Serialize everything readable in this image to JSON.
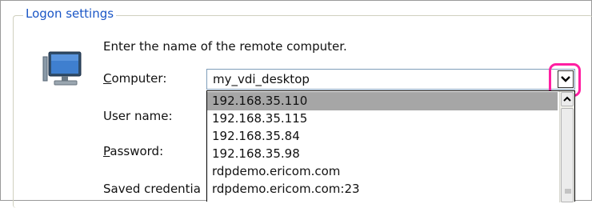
{
  "group": {
    "title": "Logon settings"
  },
  "instruction": "Enter the name of the remote computer.",
  "labels": {
    "computer": {
      "before": "",
      "mnemonic": "C",
      "after": "omputer:"
    },
    "username": "User name:",
    "password": {
      "before": "",
      "mnemonic": "P",
      "after": "assword:"
    },
    "saved": "Saved credentia"
  },
  "combo": {
    "value": "my_vdi_desktop"
  },
  "dropdown": {
    "items": [
      "192.168.35.110",
      "192.168.35.115",
      "192.168.35.84",
      "192.168.35.98",
      "rdpdemo.ericom.com",
      "rdpdemo.ericom.com:23"
    ],
    "selected_index": 0
  },
  "colors": {
    "group_title": "#1a56c6",
    "highlight": "#ff1fa2",
    "selected_item": "#a6a6a6"
  },
  "icons": {
    "computer": "monitor-icon",
    "dropdown": "chevron-down-icon",
    "scroll_up": "chevron-up-icon"
  }
}
